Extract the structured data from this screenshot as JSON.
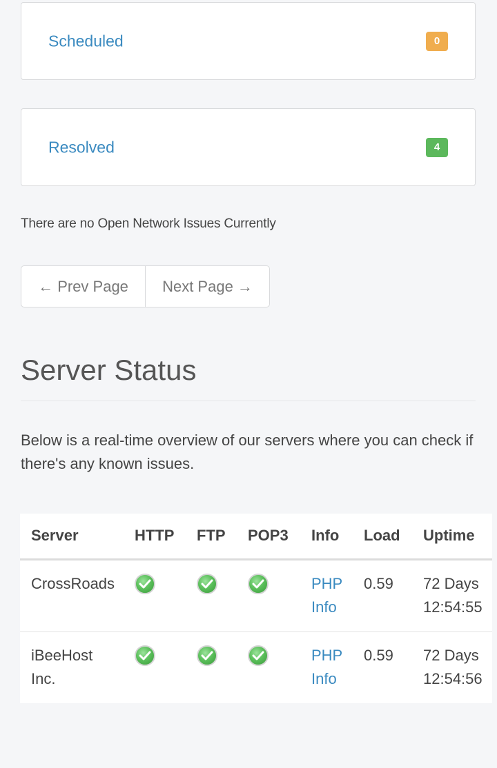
{
  "issues": {
    "scheduled": {
      "label": "Scheduled",
      "count": "0"
    },
    "resolved": {
      "label": "Resolved",
      "count": "4"
    },
    "no_open_text": "There are no Open Network Issues Currently"
  },
  "pager": {
    "prev": "← Prev Page",
    "next": "Next Page →"
  },
  "server_status": {
    "title": "Server Status",
    "intro": "Below is a real-time overview of our servers where you can check if there's any known issues.",
    "columns": [
      "Server",
      "HTTP",
      "FTP",
      "POP3",
      "Info",
      "Load",
      "Uptime"
    ],
    "rows": [
      {
        "server": "CrossRoads",
        "http": "ok",
        "ftp": "ok",
        "pop3": "ok",
        "info_line1": "PHP",
        "info_line2": "Info",
        "load": "0.59",
        "uptime_line1": "72 Days",
        "uptime_line2": "12:54:55"
      },
      {
        "server_line1": "iBeeHost",
        "server_line2": "Inc.",
        "http": "ok",
        "ftp": "ok",
        "pop3": "ok",
        "info_line1": "PHP",
        "info_line2": "Info",
        "load": "0.59",
        "uptime_line1": "72 Days",
        "uptime_line2": "12:54:56"
      }
    ]
  },
  "colors": {
    "link": "#3a8ac0",
    "badge_orange": "#f0ad4e",
    "badge_green": "#5cb85c"
  }
}
